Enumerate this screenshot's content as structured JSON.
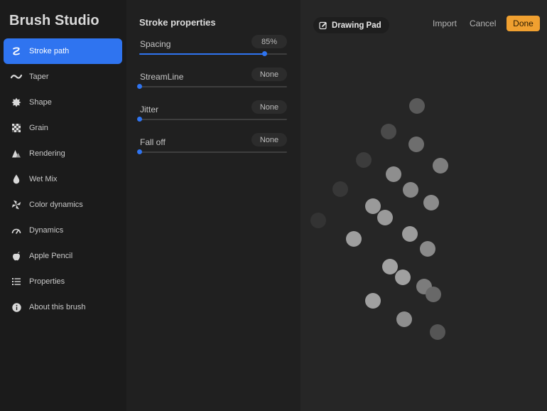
{
  "app": {
    "title": "Brush Studio"
  },
  "sidebar": {
    "items": [
      {
        "label": "Stroke path",
        "icon": "stroke-path-icon",
        "active": true
      },
      {
        "label": "Taper",
        "icon": "taper-icon"
      },
      {
        "label": "Shape",
        "icon": "shape-icon"
      },
      {
        "label": "Grain",
        "icon": "grain-icon"
      },
      {
        "label": "Rendering",
        "icon": "rendering-icon"
      },
      {
        "label": "Wet Mix",
        "icon": "wet-mix-icon"
      },
      {
        "label": "Color dynamics",
        "icon": "color-dynamics-icon"
      },
      {
        "label": "Dynamics",
        "icon": "dynamics-icon"
      },
      {
        "label": "Apple Pencil",
        "icon": "apple-pencil-icon"
      },
      {
        "label": "Properties",
        "icon": "properties-icon"
      },
      {
        "label": "About this brush",
        "icon": "info-icon"
      }
    ]
  },
  "panel": {
    "title": "Stroke properties",
    "properties": [
      {
        "label": "Spacing",
        "value": "85%",
        "fraction": 0.85
      },
      {
        "label": "StreamLine",
        "value": "None",
        "fraction": 0
      },
      {
        "label": "Jitter",
        "value": "None",
        "fraction": 0
      },
      {
        "label": "Fall off",
        "value": "None",
        "fraction": 0
      }
    ]
  },
  "canvas": {
    "pad_label": "Drawing Pad",
    "import_label": "Import",
    "cancel_label": "Cancel",
    "done_label": "Done"
  },
  "colors": {
    "accent": "#2f74f0",
    "done": "#f0a030"
  }
}
